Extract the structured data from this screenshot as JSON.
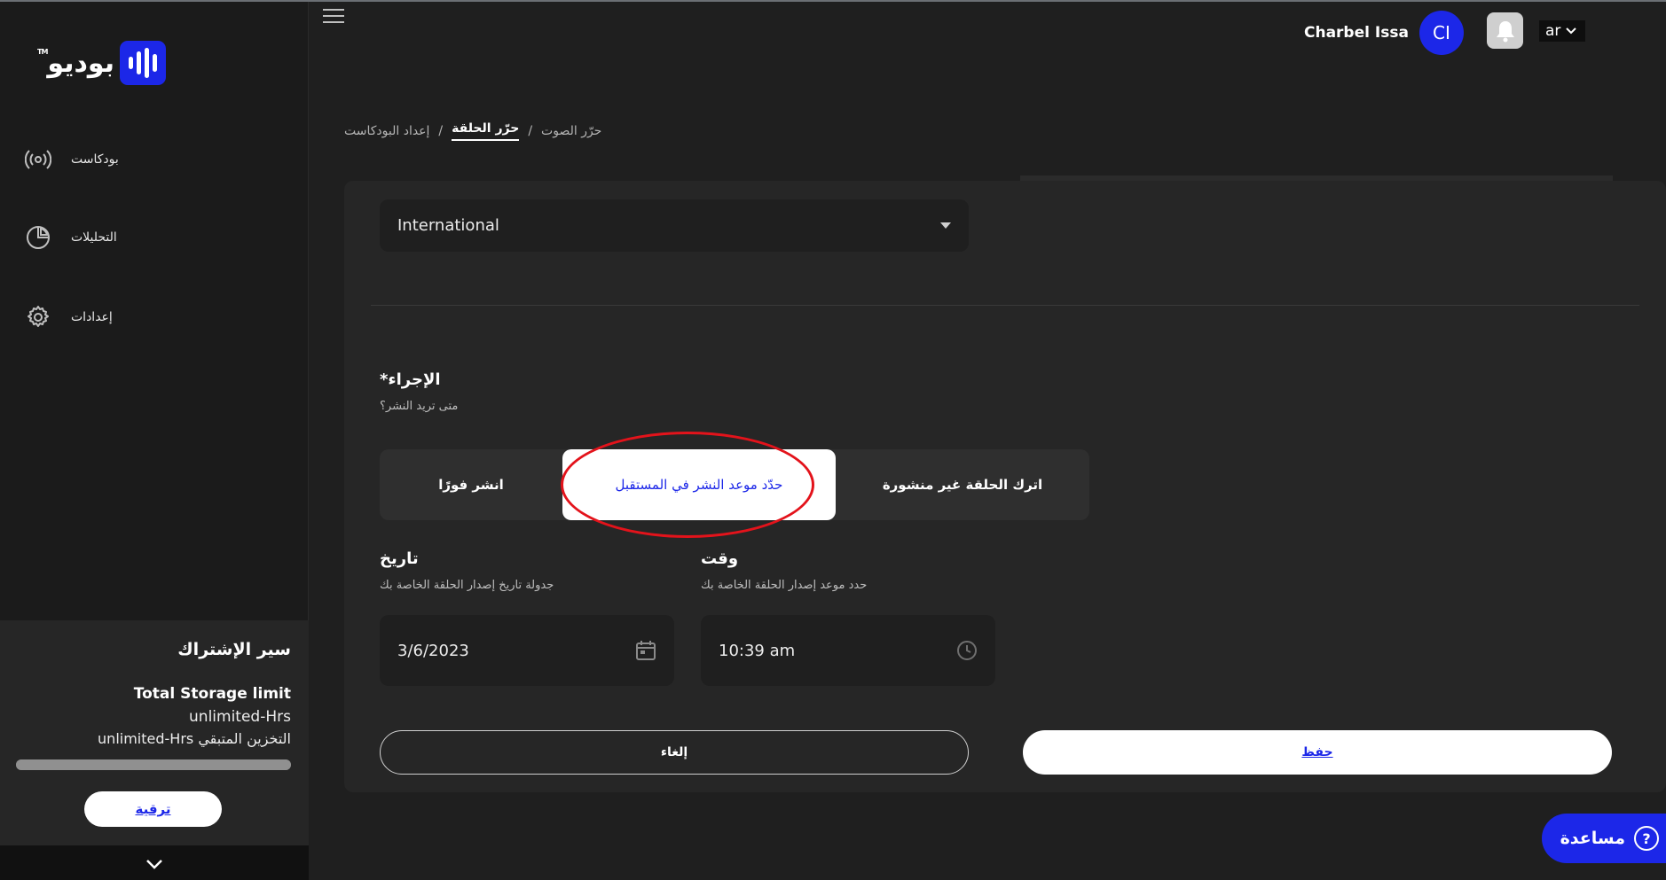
{
  "brand": {
    "logo_text": "بوديو",
    "tm": "TM"
  },
  "sidebar": {
    "items": [
      {
        "label": "بودكاست",
        "icon": "podcast-icon"
      },
      {
        "label": "التحليلات",
        "icon": "pie-chart-icon"
      },
      {
        "label": "إعدادات",
        "icon": "gear-icon"
      }
    ]
  },
  "subscription": {
    "title": "سير الإشتراك",
    "storage_title": "Total Storage limit",
    "storage_value": "unlimited-Hrs",
    "remaining": "التخزين المتبقي unlimited-Hrs",
    "progress": 1.0,
    "upgrade_label": "ترقية"
  },
  "header": {
    "user_name": "Charbel Issa",
    "avatar_initials": "CI",
    "language": "ar"
  },
  "breadcrumb": {
    "items": [
      "حرّر الصوت",
      "حرّر الحلقة",
      "إعداد البودكاست"
    ],
    "active_index": 1
  },
  "form": {
    "region_select": "International",
    "action_title": "الإجراء*",
    "action_sub": "متى تريد النشر؟",
    "options": {
      "publish_now": "انشر فورًا",
      "schedule": "حدّد موعد النشر في المستقبل",
      "unpublished": "اترك الحلقة غير منشورة"
    },
    "selected_option": "schedule",
    "date_label": "تاريخ",
    "date_sub": "جدولة تاريخ إصدار الحلقة الخاصة بك",
    "date_value": "3/6/2023",
    "time_label": "وقت",
    "time_sub": "حدد موعد إصدار الحلقة الخاصة بك",
    "time_value": "10:39 am",
    "cancel_label": "إلغاء",
    "save_label": "حفظ"
  },
  "help": {
    "label": "مساعدة"
  },
  "colors": {
    "brand_blue": "#1c27e8",
    "annotation_red": "#e3131b"
  }
}
